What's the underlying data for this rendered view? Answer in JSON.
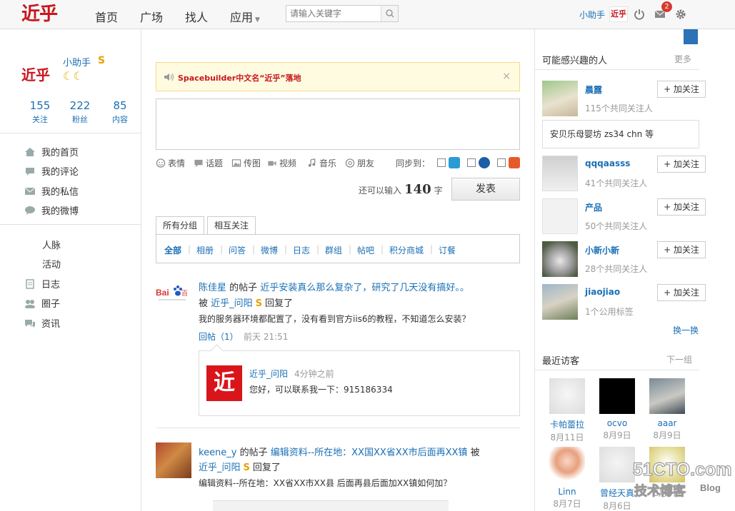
{
  "colors": {
    "brand_red": "#c8161d",
    "link_blue": "#1a6fb5",
    "badge_red": "#d9382e",
    "notice_bg": "#fffbe0"
  },
  "topbar": {
    "logo_text": "近乎",
    "nav": [
      "首页",
      "广场",
      "找人",
      "应用"
    ],
    "search_placeholder": "请输入关键字",
    "username": "小助手",
    "mini_logo": "近乎",
    "message_count": "2",
    "icons": [
      "power-icon",
      "mail-icon",
      "gear-icon"
    ]
  },
  "sidebar": {
    "logo_text": "近乎",
    "name": "小助手",
    "badge": "S",
    "level": "☾☾",
    "stats": [
      {
        "value": "155",
        "label": "关注"
      },
      {
        "value": "222",
        "label": "粉丝"
      },
      {
        "value": "85",
        "label": "内容"
      }
    ],
    "menu": [
      {
        "icon": "home-icon",
        "label": "我的首页"
      },
      {
        "icon": "comment-icon",
        "label": "我的评论"
      },
      {
        "icon": "envelope-icon",
        "label": "我的私信"
      },
      {
        "icon": "chat-icon",
        "label": "我的微博"
      }
    ],
    "menu2": [
      {
        "icon": "",
        "label": "人脉"
      },
      {
        "icon": "",
        "label": "活动"
      },
      {
        "icon": "log-icon",
        "label": "日志"
      },
      {
        "icon": "group-icon",
        "label": "圈子"
      },
      {
        "icon": "news-icon",
        "label": "资讯"
      }
    ]
  },
  "notice": {
    "text": "Spacebuilder中文名“近乎”落地",
    "close": "×"
  },
  "composer": {
    "tools": [
      "表情",
      "话题",
      "传图",
      "视频",
      "音乐",
      "朋友"
    ],
    "sync_label": "同步到：",
    "remain_prefix": "还可以输入",
    "remain_count": "140",
    "remain_suffix": "字",
    "publish": "发表"
  },
  "tabs": [
    "所有分组",
    "相互关注"
  ],
  "filters": [
    "全部",
    "相册",
    "问答",
    "微博",
    "日志",
    "群组",
    "帖吧",
    "积分商城",
    "订餐"
  ],
  "feed": [
    {
      "avatar": "baidu-avatar",
      "author": "陈佳星",
      "verb": "的帖子",
      "title": "近乎安装真么那么复杂了，研究了几天没有搞好。。",
      "by": "被",
      "replier": "近乎_问阳",
      "replier_badge": "S",
      "action": "回复了",
      "body": "我的服务器环境都配置了，没有看到官方iis6的教程，不知道怎么安装？",
      "reply_label": "回帖（1）",
      "time": "前天 21:51",
      "reply": {
        "avatar_text": "近",
        "name": "近乎_问阳",
        "time": "4分钟之前",
        "text": "您好，可以联系我一下：915186334"
      }
    },
    {
      "avatar": "photo-avatar",
      "author": "keene_y",
      "verb": "的帖子",
      "title": "编辑资料--所在地：XX国XX省XX市后面再XX镇",
      "by": "被",
      "replier": "近乎_问阳",
      "replier_badge": "S",
      "action": "回复了",
      "body": "编辑资料--所在地：XX省XX市XX县 后面再县后面加XX镇如何加？"
    }
  ],
  "right": {
    "interest_title": "可能感兴趣的人",
    "interest_more": "更多",
    "follow_label": "+ 加关注",
    "people": [
      {
        "name": "晨露",
        "common": "115个共同关注人"
      },
      {
        "name": "qqqaasss",
        "common": "41个共同关注人"
      },
      {
        "name": "产品",
        "common": "50个共同关注人"
      },
      {
        "name": "小新小新",
        "common": "28个共同关注人"
      },
      {
        "name": "jiaojiao",
        "common": "1个公用标签"
      }
    ],
    "mutual_text": "安贝乐母婴坊 zs34 chn 等",
    "swap": "换一换",
    "visitors_title": "最近访客",
    "visitors_next": "下一组",
    "visitors": [
      {
        "name": "卡帕蕾拉",
        "date": "8月11日"
      },
      {
        "name": "ocvo",
        "date": "8月9日"
      },
      {
        "name": "aaar",
        "date": "8月9日"
      },
      {
        "name": "Linn",
        "date": "8月7日"
      },
      {
        "name": "曾经天真",
        "date": "8月6日"
      },
      {
        "name": "",
        "date": "8月6日"
      }
    ]
  },
  "watermark": {
    "main": "51CTO.com",
    "sub": "技术博客",
    "tag": "Blog"
  }
}
